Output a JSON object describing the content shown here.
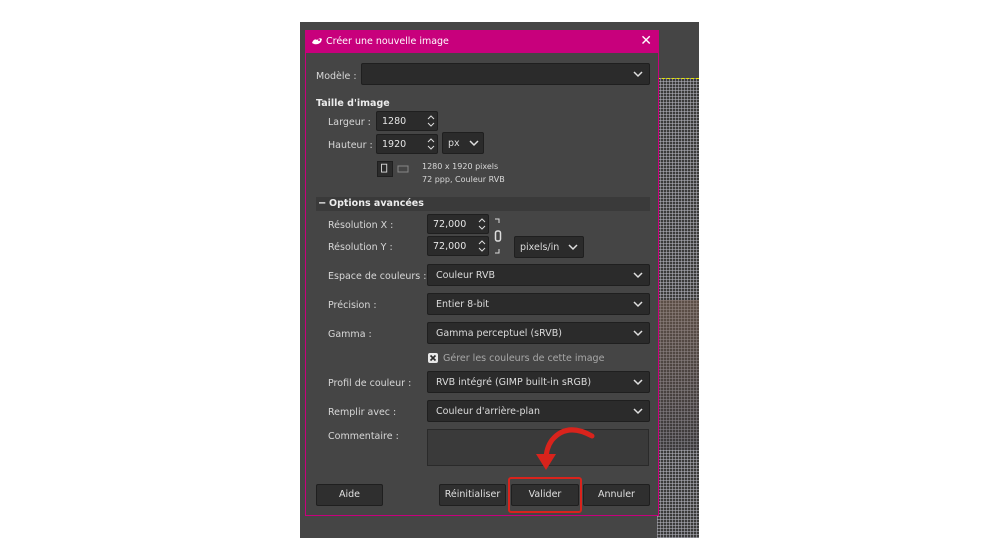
{
  "dialog": {
    "title": "Créer une nouvelle image",
    "accent_color": "#c8007c"
  },
  "template": {
    "label": "Modèle :",
    "value": ""
  },
  "image_size": {
    "heading": "Taille d'image",
    "width_label": "Largeur :",
    "width_value": "1280",
    "height_label": "Hauteur :",
    "height_value": "1920",
    "unit": "px",
    "info_line1": "1280 x 1920 pixels",
    "info_line2": "72 ppp, Couleur RVB"
  },
  "advanced": {
    "heading": "Options avancées",
    "res_x_label": "Résolution X :",
    "res_x_value": "72,000",
    "res_y_label": "Résolution Y :",
    "res_y_value": "72,000",
    "res_unit": "pixels/in",
    "colorspace_label": "Espace de couleurs :",
    "colorspace_value": "Couleur RVB",
    "precision_label": "Précision :",
    "precision_value": "Entier 8-bit",
    "gamma_label": "Gamma :",
    "gamma_value": "Gamma perceptuel (sRVB)",
    "manage_colors_label": "Gérer les couleurs de cette image",
    "manage_colors_checked": true,
    "profile_label": "Profil de couleur :",
    "profile_value": "RVB intégré (GIMP built-in sRGB)",
    "fill_label": "Remplir avec :",
    "fill_value": "Couleur d'arrière-plan",
    "comment_label": "Commentaire :"
  },
  "buttons": {
    "help": "Aide",
    "reset": "Réinitialiser",
    "ok": "Valider",
    "cancel": "Annuler"
  },
  "annotation_color": "#d9231c"
}
